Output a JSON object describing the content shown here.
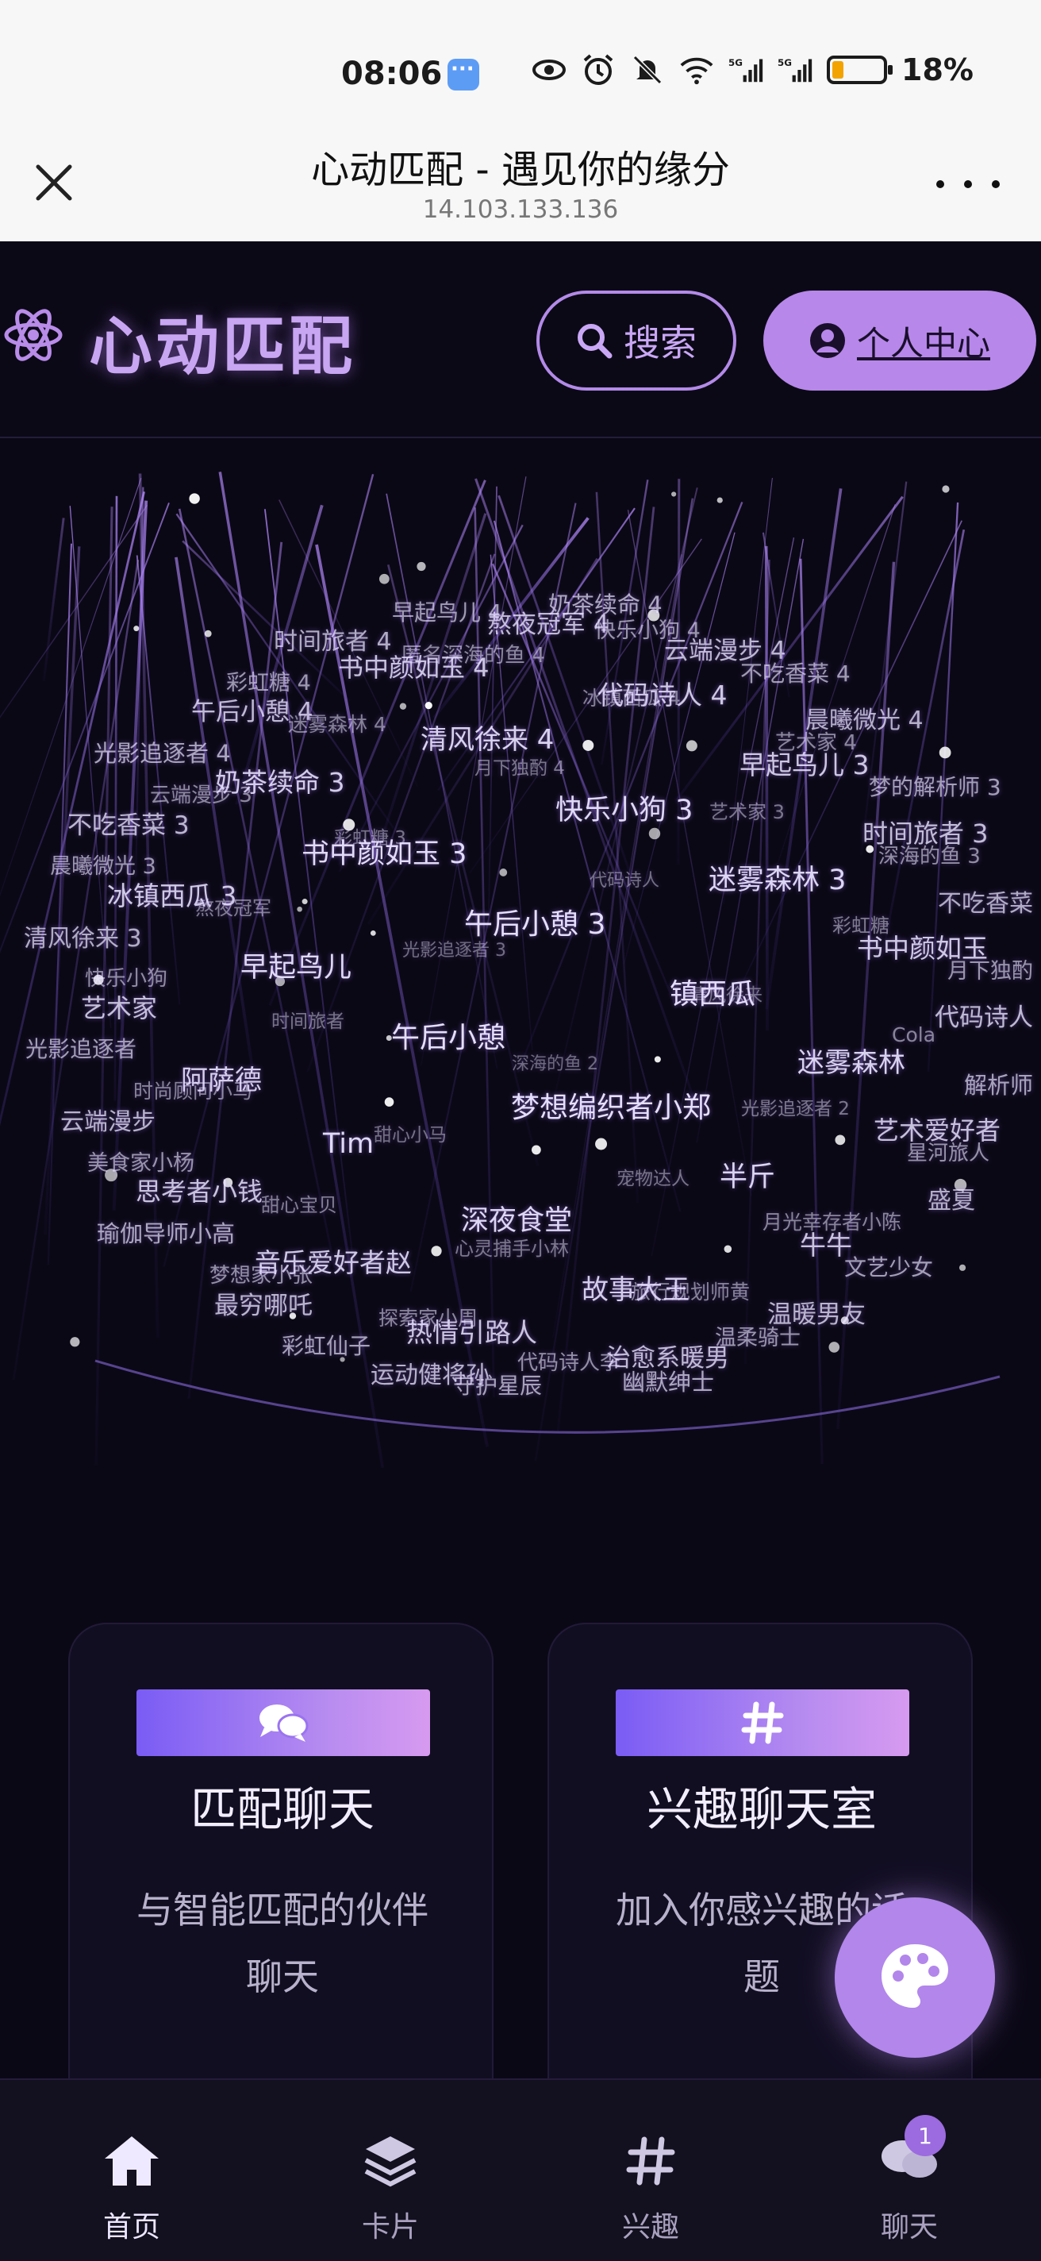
{
  "status_bar": {
    "time": "08:06",
    "battery": "18%",
    "icons": [
      "message-icon",
      "eye-icon",
      "alarm-icon",
      "mute-icon",
      "wifi-icon",
      "signal-5g-icon",
      "signal-5g-icon",
      "battery-icon"
    ]
  },
  "browser": {
    "title": "心动匹配 - 遇见你的缘分",
    "url": "14.103.133.136"
  },
  "app_header": {
    "logo": "心动匹配",
    "search_label": "搜索",
    "profile_label": "个人中心"
  },
  "sphere_words": [
    "奶茶续命 4",
    "早起鸟儿 4",
    "熬夜冠军 4",
    "快乐小狗 4",
    "时间旅者 4",
    "云端漫步 4",
    "匿名深海的鱼 4",
    "书中颜如玉 4",
    "不吃香菜 4",
    "彩虹糖 4",
    "代码诗人 4",
    "冰镇西瓜 4",
    "午后小憩 4",
    "晨曦微光 4",
    "迷雾森林 4",
    "清风徐来 4",
    "艺术家 4",
    "光影追逐者 4",
    "早起鸟儿 3",
    "月下独酌 4",
    "奶茶续命 3",
    "梦的解析师 3",
    "云端漫步 3",
    "快乐小狗 3",
    "艺术家 3",
    "不吃香菜 3",
    "时间旅者 3",
    "彩虹糖 3",
    "书中颜如玉 3",
    "深海的鱼 3",
    "晨曦微光 3",
    "迷雾森林 3",
    "代码诗人",
    "冰镇西瓜 3",
    "不吃香菜",
    "熬夜冠军",
    "午后小憩 3",
    "彩虹糖",
    "清风徐来 3",
    "书中颜如玉",
    "光影追逐者 3",
    "早起鸟儿",
    "月下独酌",
    "快乐小狗",
    "镇西瓜",
    "清风徐来",
    "艺术家",
    "代码诗人",
    "时间旅者",
    "午后小憩",
    "Cola",
    "光影追逐者",
    "迷雾森林",
    "深海的鱼 2",
    "阿萨德",
    "解析师",
    "时尚顾问小马",
    "梦想编织者小郑",
    "光影追逐者 2",
    "云端漫步",
    "艺术爱好者",
    "甜心小马",
    "Tim",
    "星河旅人",
    "美食家小杨",
    "半斤",
    "宠物达人",
    "思考者小钱",
    "盛夏",
    "甜心宝贝",
    "深夜食堂",
    "月光幸存者小陈",
    "瑜伽导师小高",
    "牛牛",
    "心灵捕手小林",
    "音乐爱好者赵",
    "文艺少女",
    "梦想家小张",
    "故事大王",
    "旅行规划师黄",
    "最穷哪吒",
    "温暖男友",
    "探索家小周",
    "热情引路人",
    "温柔骑士",
    "彩虹仙子",
    "治愈系暖男",
    "代码诗人李",
    "运动健将孙",
    "幽默绅士",
    "守护星辰"
  ],
  "cards": [
    {
      "title": "匹配聊天",
      "desc": "与智能匹配的伙伴聊天",
      "icon": "chat-bubbles-icon"
    },
    {
      "title": "兴趣聊天室",
      "desc": "加入你感兴趣的话题",
      "icon": "hashtag-icon"
    }
  ],
  "fab_icon": "palette-icon",
  "nav": [
    {
      "label": "首页",
      "icon": "home-icon",
      "active": true
    },
    {
      "label": "卡片",
      "icon": "layers-icon",
      "active": false
    },
    {
      "label": "兴趣",
      "icon": "hashtag-icon",
      "active": false
    },
    {
      "label": "聊天",
      "icon": "chat-icon",
      "active": false,
      "badge": "1"
    }
  ],
  "colors": {
    "background": "#0b0816",
    "accent": "#b787ea",
    "accent_gradient_start": "#7a5cf5",
    "accent_gradient_end": "#d79af0",
    "status_bar_bg": "#f7f7f8"
  }
}
